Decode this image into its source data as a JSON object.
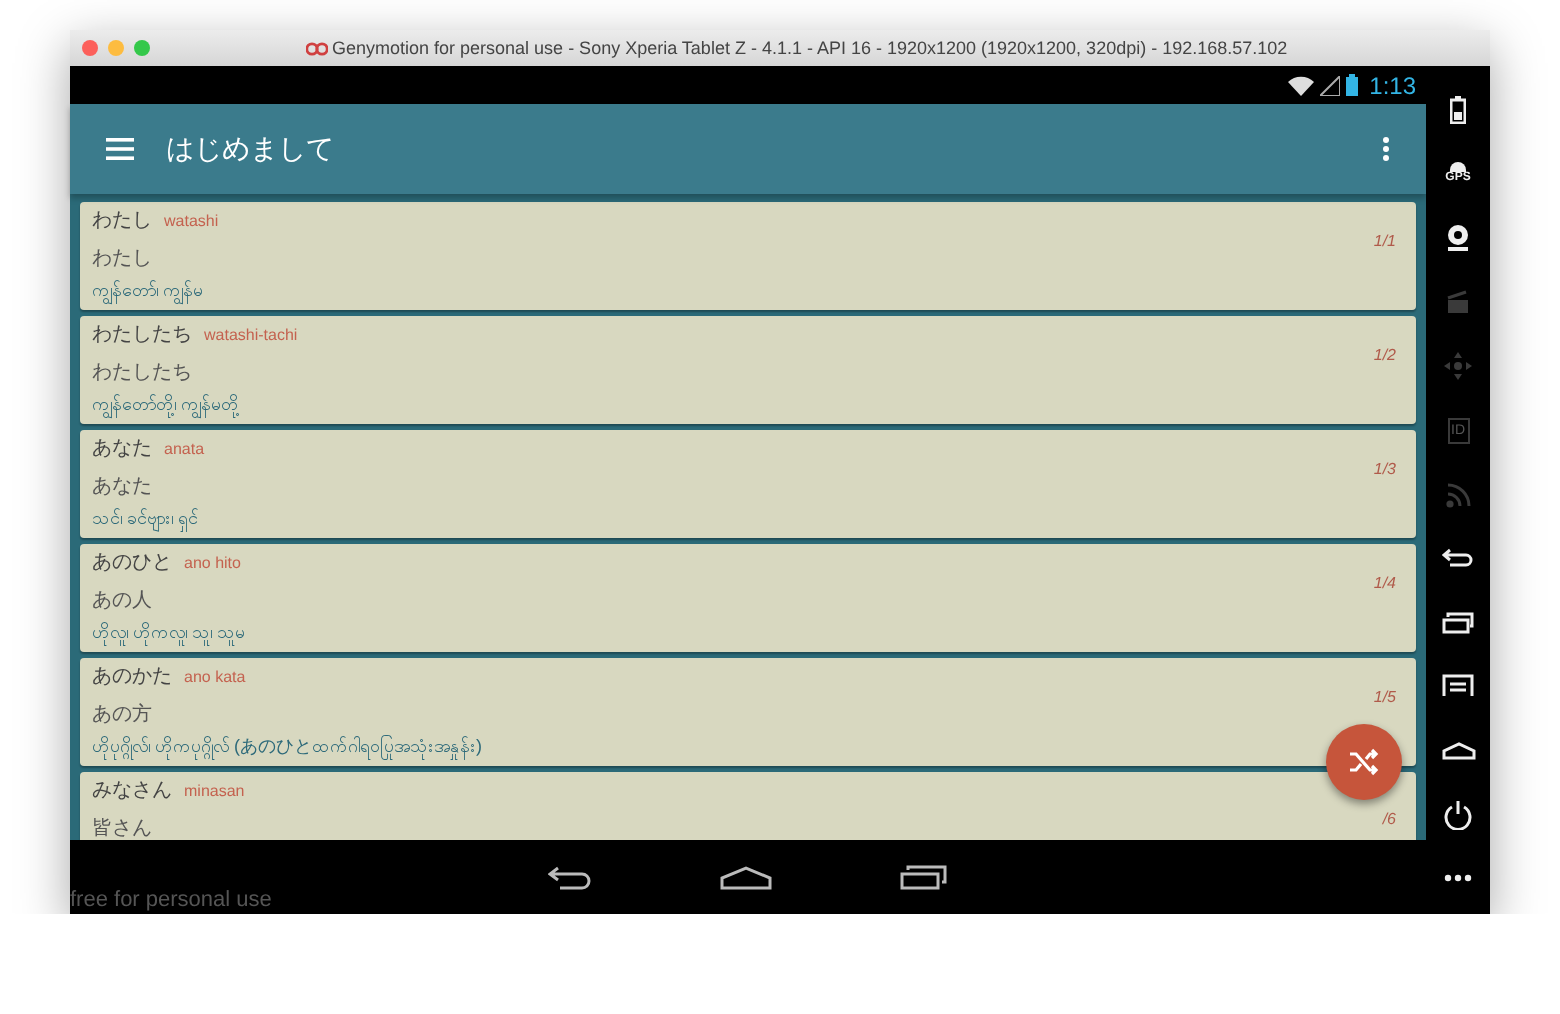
{
  "window": {
    "title": "Genymotion for personal use - Sony Xperia Tablet Z - 4.1.1 - API 16 - 1920x1200 (1920x1200, 320dpi) - 192.168.57.102"
  },
  "status_bar": {
    "time": "1:13"
  },
  "app_bar": {
    "title": "はじめまして"
  },
  "cards": [
    {
      "word": "わたし",
      "romaji": "watashi",
      "reading": "わたし",
      "meaning": "ကျွန်တော်၊ ကျွန်မ",
      "count": "1/1"
    },
    {
      "word": "わたしたち",
      "romaji": "watashi-tachi",
      "reading": "わたしたち",
      "meaning": "ကျွန်တော်တို့၊ ကျွန်မတို့",
      "count": "1/2"
    },
    {
      "word": "あなた",
      "romaji": "anata",
      "reading": "あなた",
      "meaning": "သင်၊ ခင်ဗျား၊ ရှင်",
      "count": "1/3"
    },
    {
      "word": "あのひと",
      "romaji": "ano hito",
      "reading": "あの人",
      "meaning": "ဟိုလူ၊ ဟိုကလူ၊ သူ၊ သူမ",
      "count": "1/4"
    },
    {
      "word": "あのかた",
      "romaji": "ano kata",
      "reading": "あの方",
      "meaning": "ဟိုပုဂ္ဂိုလ်၊ ဟိုကပုဂ္ဂိုလ် (あのひとထက်ဂါရဝပြုအသုံးအနှုန်း)",
      "count": "1/5"
    },
    {
      "word": "みなさん",
      "romaji": "minasan",
      "reading": "皆さん",
      "count": "/6"
    }
  ],
  "emulator_notice": "free for personal use",
  "nav_buttons": [
    {
      "kind": "back"
    },
    {
      "kind": "home"
    },
    {
      "kind": "recents"
    }
  ],
  "side_toolbar": [
    {
      "kind": "battery",
      "disabled": false
    },
    {
      "kind": "gps",
      "label": "GPS",
      "disabled": false
    },
    {
      "kind": "webcam",
      "disabled": false
    },
    {
      "kind": "clapperboard",
      "disabled": true
    },
    {
      "kind": "dpad",
      "disabled": true
    },
    {
      "kind": "id",
      "label": "ID",
      "disabled": true
    },
    {
      "kind": "signal",
      "disabled": true
    },
    {
      "kind": "back",
      "disabled": false
    },
    {
      "kind": "recents",
      "disabled": false
    },
    {
      "kind": "menu",
      "disabled": false
    },
    {
      "kind": "home",
      "disabled": false
    },
    {
      "kind": "power",
      "disabled": false
    },
    {
      "kind": "more",
      "disabled": false
    }
  ]
}
